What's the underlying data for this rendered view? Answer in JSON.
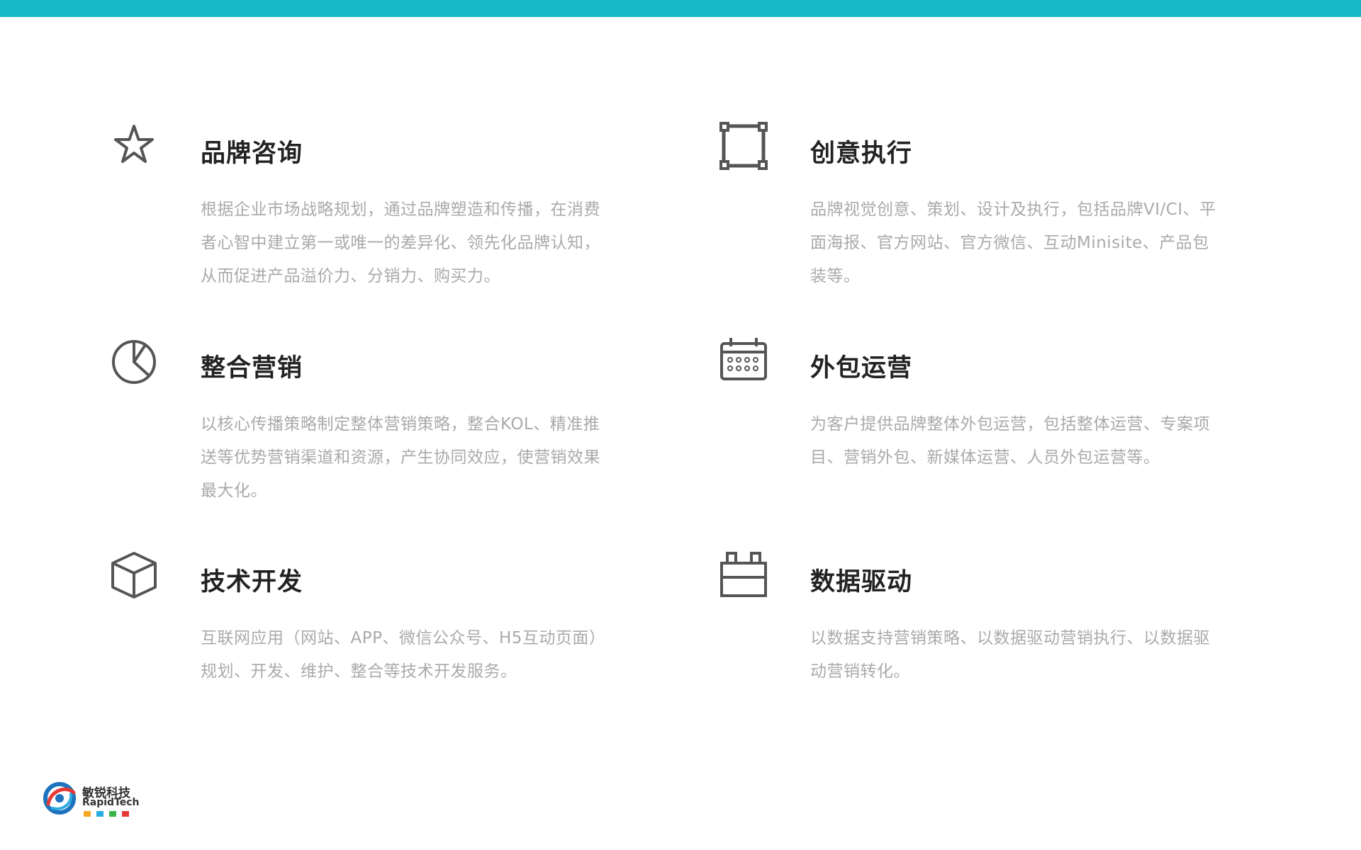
{
  "colors": {
    "accent_bar": "#14b8c6",
    "title": "#222222",
    "description": "#aaaaaa",
    "icon": "#555555"
  },
  "services": [
    {
      "icon": "star-icon",
      "title": "品牌咨询",
      "description": "根据企业市场战略规划，通过品牌塑造和传播，在消费者心智中建立第一或唯一的差异化、领先化品牌认知，从而促进产品溢价力、分销力、购买力。"
    },
    {
      "icon": "frame-icon",
      "title": "创意执行",
      "description": "品牌视觉创意、策划、设计及执行，包括品牌VI/CI、平面海报、官方网站、官方微信、互动Minisite、产品包装等。"
    },
    {
      "icon": "pie-chart-icon",
      "title": "整合营销",
      "description": "以核心传播策略制定整体营销策略，整合KOL、精准推送等优势营销渠道和资源，产生协同效应，使营销效果最大化。"
    },
    {
      "icon": "calendar-icon",
      "title": "外包运营",
      "description": "为客户提供品牌整体外包运营，包括整体运营、专案项目、营销外包、新媒体运营、人员外包运营等。"
    },
    {
      "icon": "cube-icon",
      "title": "技术开发",
      "description": "互联网应用（网站、APP、微信公众号、H5互动页面）规划、开发、维护、整合等技术开发服务。"
    },
    {
      "icon": "data-block-icon",
      "title": "数据驱动",
      "description": "以数据支持营销策略、以数据驱动营销执行、以数据驱动营销转化。"
    }
  ],
  "logo": {
    "name_cn": "敏锐科技",
    "name_en": "RapidTech",
    "dot_colors": [
      "#f5a623",
      "#29abe2",
      "#39b54a",
      "#e53935"
    ]
  }
}
